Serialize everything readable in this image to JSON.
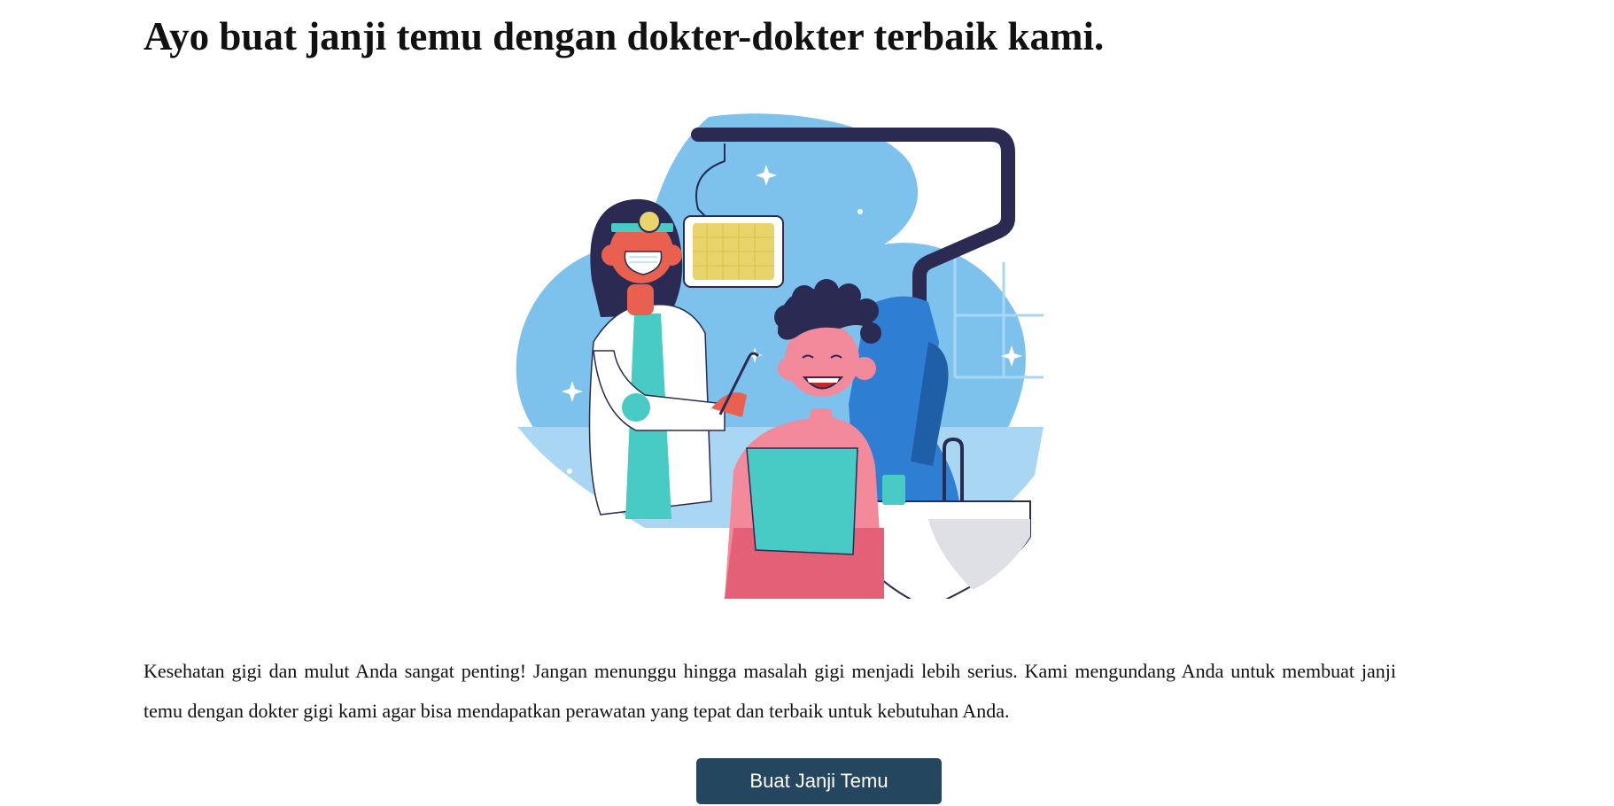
{
  "heading": "Ayo buat janji temu dengan dokter-dokter terbaik kami.",
  "illustration": {
    "icon": "dentist-examining-patient-illustration",
    "colors": {
      "sky_blue": "#7cc2ec",
      "light_blue": "#a9d7f3",
      "navy": "#2b2a52",
      "chair_blue": "#2e7fd4",
      "teal": "#48cbc4",
      "skin": "#e9604e",
      "patient_skin": "#f38a9b",
      "lamp_yellow": "#e8d46a"
    }
  },
  "description": "Kesehatan gigi dan mulut Anda sangat penting! Jangan menunggu hingga masalah gigi menjadi lebih serius. Kami mengundang Anda untuk membuat janji temu dengan dokter gigi kami agar bisa mendapatkan perawatan yang tepat dan terbaik untuk kebutuhan Anda.",
  "cta": {
    "label": "Buat Janji Temu",
    "color": "#25465f"
  }
}
